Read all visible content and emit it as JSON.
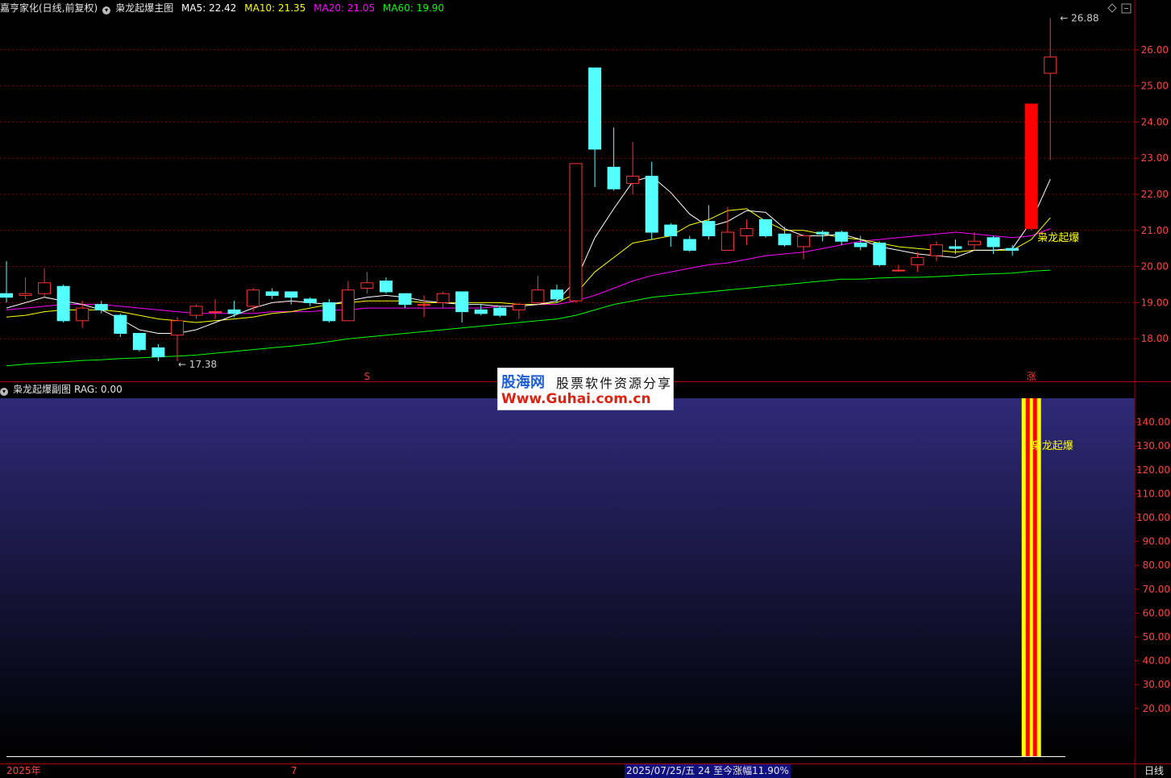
{
  "window": {
    "stock_name": "嘉亨家化(日线,前复权)",
    "main_indicator": "枭龙起爆主图",
    "sub_indicator": "枭龙起爆副图",
    "sub_value_label": "RAG: 0.00",
    "period_label": "日线"
  },
  "ma_legend": [
    {
      "label": "MA5: 22.42",
      "color": "#ffffff"
    },
    {
      "label": "MA10: 21.35",
      "color": "#ffff00"
    },
    {
      "label": "MA20: 21.05",
      "color": "#ff00ff"
    },
    {
      "label": "MA60: 19.90",
      "color": "#00ff00"
    }
  ],
  "annotations": {
    "high_price": "26.88",
    "low_price": "17.38",
    "signal_text": "枭龙起爆",
    "sub_signal_text": "枭龙起爆",
    "marker_s": "S",
    "marker_zhang": "涨"
  },
  "watermark": {
    "line1": "股海网",
    "line2": "股票软件资源分享",
    "line3": "Www.Guhai.com.cn"
  },
  "status_bar": {
    "year": "2025年",
    "month": "7",
    "info": "2025/07/25/五 24 至今涨幅11.90%"
  },
  "colors": {
    "up": "#ff3232",
    "down": "#54ffff",
    "grid": "#8b0000",
    "ma5": "#ffffff",
    "ma10": "#ffff00",
    "ma20": "#ff00ff",
    "ma60": "#00ff00",
    "signal_bar_red": "#ff0000",
    "signal_bar_yellow": "#ffff00"
  },
  "chart_data": [
    {
      "type": "candlestick",
      "title": "枭龙起爆主图",
      "y_ticks": [
        18.0,
        19.0,
        20.0,
        21.0,
        22.0,
        23.0,
        24.0,
        25.0,
        26.0
      ],
      "ylim": [
        17.0,
        27.0
      ],
      "candles": [
        {
          "o": 19.25,
          "c": 19.15,
          "h": 20.15,
          "l": 19.0
        },
        {
          "o": 19.2,
          "c": 19.25,
          "h": 19.7,
          "l": 19.1
        },
        {
          "o": 19.25,
          "c": 19.55,
          "h": 19.95,
          "l": 19.15
        },
        {
          "o": 19.45,
          "c": 18.5,
          "h": 19.5,
          "l": 18.45
        },
        {
          "o": 18.5,
          "c": 18.85,
          "h": 19.05,
          "l": 18.3
        },
        {
          "o": 18.95,
          "c": 18.8,
          "h": 19.05,
          "l": 18.7
        },
        {
          "o": 18.65,
          "c": 18.15,
          "h": 18.7,
          "l": 18.05
        },
        {
          "o": 18.15,
          "c": 17.7,
          "h": 18.15,
          "l": 17.65
        },
        {
          "o": 17.75,
          "c": 17.5,
          "h": 17.85,
          "l": 17.38
        },
        {
          "o": 18.1,
          "c": 18.5,
          "h": 18.6,
          "l": 17.38
        },
        {
          "o": 18.65,
          "c": 18.9,
          "h": 18.95,
          "l": 18.55
        },
        {
          "o": 18.75,
          "c": 18.75,
          "h": 19.1,
          "l": 18.55
        },
        {
          "o": 18.8,
          "c": 18.7,
          "h": 19.05,
          "l": 18.6
        },
        {
          "o": 18.9,
          "c": 19.35,
          "h": 19.4,
          "l": 18.75
        },
        {
          "o": 19.3,
          "c": 19.2,
          "h": 19.4,
          "l": 19.1
        },
        {
          "o": 19.3,
          "c": 19.15,
          "h": 19.3,
          "l": 18.95
        },
        {
          "o": 19.1,
          "c": 19.0,
          "h": 19.15,
          "l": 18.9
        },
        {
          "o": 19.0,
          "c": 18.5,
          "h": 19.1,
          "l": 18.45
        },
        {
          "o": 18.5,
          "c": 19.35,
          "h": 19.6,
          "l": 18.5
        },
        {
          "o": 19.4,
          "c": 19.55,
          "h": 19.85,
          "l": 19.25
        },
        {
          "o": 19.6,
          "c": 19.3,
          "h": 19.7,
          "l": 19.25
        },
        {
          "o": 19.25,
          "c": 18.95,
          "h": 19.25,
          "l": 18.85
        },
        {
          "o": 18.95,
          "c": 18.95,
          "h": 19.2,
          "l": 18.6
        },
        {
          "o": 19.0,
          "c": 19.25,
          "h": 19.3,
          "l": 18.85
        },
        {
          "o": 19.3,
          "c": 18.75,
          "h": 19.3,
          "l": 18.45
        },
        {
          "o": 18.8,
          "c": 18.7,
          "h": 18.95,
          "l": 18.65
        },
        {
          "o": 18.85,
          "c": 18.65,
          "h": 18.9,
          "l": 18.6
        },
        {
          "o": 18.8,
          "c": 18.95,
          "h": 19.0,
          "l": 18.55
        },
        {
          "o": 19.0,
          "c": 19.35,
          "h": 19.75,
          "l": 18.95
        },
        {
          "o": 19.35,
          "c": 19.1,
          "h": 19.5,
          "l": 19.0
        },
        {
          "o": 19.05,
          "c": 22.85,
          "h": 22.85,
          "l": 19.0
        },
        {
          "o": 25.5,
          "c": 23.25,
          "h": 25.5,
          "l": 22.2
        },
        {
          "o": 22.75,
          "c": 22.15,
          "h": 23.85,
          "l": 22.1
        },
        {
          "o": 22.3,
          "c": 22.5,
          "h": 23.45,
          "l": 22.0
        },
        {
          "o": 22.5,
          "c": 20.95,
          "h": 22.9,
          "l": 20.75
        },
        {
          "o": 21.15,
          "c": 20.85,
          "h": 21.2,
          "l": 20.55
        },
        {
          "o": 20.75,
          "c": 20.45,
          "h": 20.85,
          "l": 20.4
        },
        {
          "o": 21.25,
          "c": 20.85,
          "h": 21.7,
          "l": 20.75
        },
        {
          "o": 20.45,
          "c": 20.95,
          "h": 21.65,
          "l": 20.45
        },
        {
          "o": 20.85,
          "c": 21.05,
          "h": 21.3,
          "l": 20.6
        },
        {
          "o": 21.3,
          "c": 20.85,
          "h": 21.3,
          "l": 20.8
        },
        {
          "o": 20.9,
          "c": 20.6,
          "h": 21.1,
          "l": 20.55
        },
        {
          "o": 20.55,
          "c": 20.85,
          "h": 20.9,
          "l": 20.2
        },
        {
          "o": 20.95,
          "c": 20.9,
          "h": 21.0,
          "l": 20.7
        },
        {
          "o": 20.95,
          "c": 20.7,
          "h": 21.0,
          "l": 20.6
        },
        {
          "o": 20.65,
          "c": 20.55,
          "h": 20.85,
          "l": 20.45
        },
        {
          "o": 20.65,
          "c": 20.05,
          "h": 20.7,
          "l": 20.0
        },
        {
          "o": 19.9,
          "c": 19.9,
          "h": 20.05,
          "l": 19.85
        },
        {
          "o": 20.05,
          "c": 20.25,
          "h": 20.4,
          "l": 19.85
        },
        {
          "o": 20.3,
          "c": 20.6,
          "h": 20.7,
          "l": 20.15
        },
        {
          "o": 20.55,
          "c": 20.5,
          "h": 20.75,
          "l": 20.35
        },
        {
          "o": 20.6,
          "c": 20.7,
          "h": 20.95,
          "l": 20.45
        },
        {
          "o": 20.8,
          "c": 20.55,
          "h": 20.85,
          "l": 20.35
        },
        {
          "o": 20.5,
          "c": 20.45,
          "h": 20.6,
          "l": 20.3
        },
        {
          "o": 21.05,
          "c": 24.5,
          "h": 24.5,
          "l": 21.0
        },
        {
          "o": 25.35,
          "c": 25.8,
          "h": 26.88,
          "l": 22.95
        }
      ],
      "ma5": [
        18.85,
        19.0,
        19.15,
        19.05,
        18.95,
        18.8,
        18.55,
        18.25,
        18.15,
        18.15,
        18.25,
        18.45,
        18.65,
        18.85,
        19.0,
        19.05,
        19.0,
        18.95,
        19.05,
        19.15,
        19.2,
        19.15,
        19.05,
        19.0,
        18.95,
        18.95,
        18.9,
        18.9,
        18.95,
        19.05,
        19.6,
        20.8,
        21.6,
        22.35,
        22.5,
        22.05,
        21.45,
        21.1,
        21.25,
        21.55,
        21.5,
        21.05,
        20.85,
        20.85,
        20.9,
        20.75,
        20.55,
        20.45,
        20.35,
        20.3,
        20.25,
        20.45,
        20.45,
        20.5,
        21.25,
        22.42
      ],
      "ma10": [
        18.6,
        18.65,
        18.75,
        18.8,
        18.8,
        18.8,
        18.75,
        18.65,
        18.55,
        18.5,
        18.45,
        18.5,
        18.55,
        18.6,
        18.7,
        18.75,
        18.85,
        18.95,
        19.0,
        19.05,
        19.05,
        19.05,
        19.0,
        19.0,
        19.0,
        19.0,
        19.0,
        18.95,
        18.95,
        19.0,
        19.25,
        19.85,
        20.25,
        20.65,
        20.75,
        20.85,
        21.15,
        21.3,
        21.55,
        21.6,
        21.25,
        21.0,
        21.0,
        20.9,
        20.8,
        20.75,
        20.65,
        20.55,
        20.5,
        20.45,
        20.4,
        20.45,
        20.45,
        20.45,
        20.75,
        21.35
      ],
      "ma20": [
        18.8,
        18.85,
        18.9,
        18.95,
        18.95,
        18.95,
        18.9,
        18.85,
        18.8,
        18.75,
        18.7,
        18.7,
        18.7,
        18.7,
        18.75,
        18.75,
        18.75,
        18.8,
        18.8,
        18.85,
        18.85,
        18.85,
        18.85,
        18.85,
        18.85,
        18.85,
        18.9,
        18.9,
        18.95,
        18.95,
        19.05,
        19.2,
        19.4,
        19.6,
        19.75,
        19.85,
        19.95,
        20.05,
        20.1,
        20.2,
        20.3,
        20.35,
        20.4,
        20.5,
        20.6,
        20.7,
        20.75,
        20.8,
        20.85,
        20.9,
        20.95,
        20.9,
        20.85,
        20.8,
        20.85,
        21.05
      ],
      "ma60": [
        17.25,
        17.3,
        17.33,
        17.36,
        17.4,
        17.42,
        17.45,
        17.47,
        17.5,
        17.52,
        17.55,
        17.6,
        17.65,
        17.7,
        17.75,
        17.8,
        17.85,
        17.92,
        18.0,
        18.05,
        18.1,
        18.15,
        18.2,
        18.25,
        18.3,
        18.35,
        18.4,
        18.45,
        18.5,
        18.55,
        18.65,
        18.8,
        18.95,
        19.05,
        19.15,
        19.2,
        19.25,
        19.3,
        19.35,
        19.4,
        19.45,
        19.5,
        19.55,
        19.6,
        19.65,
        19.65,
        19.68,
        19.7,
        19.7,
        19.72,
        19.75,
        19.78,
        19.8,
        19.82,
        19.87,
        19.9
      ],
      "s_marker_index": 19,
      "zhang_marker_index": 54
    },
    {
      "type": "bar",
      "title": "枭龙起爆副图",
      "y_ticks": [
        20.0,
        30.0,
        40.0,
        50.0,
        60.0,
        70.0,
        80.0,
        90.0,
        100.0,
        110.0,
        120.0,
        130.0,
        140.0
      ],
      "ylim": [
        0,
        150
      ],
      "signal_bar_index": 54,
      "signal_value": 150
    }
  ]
}
